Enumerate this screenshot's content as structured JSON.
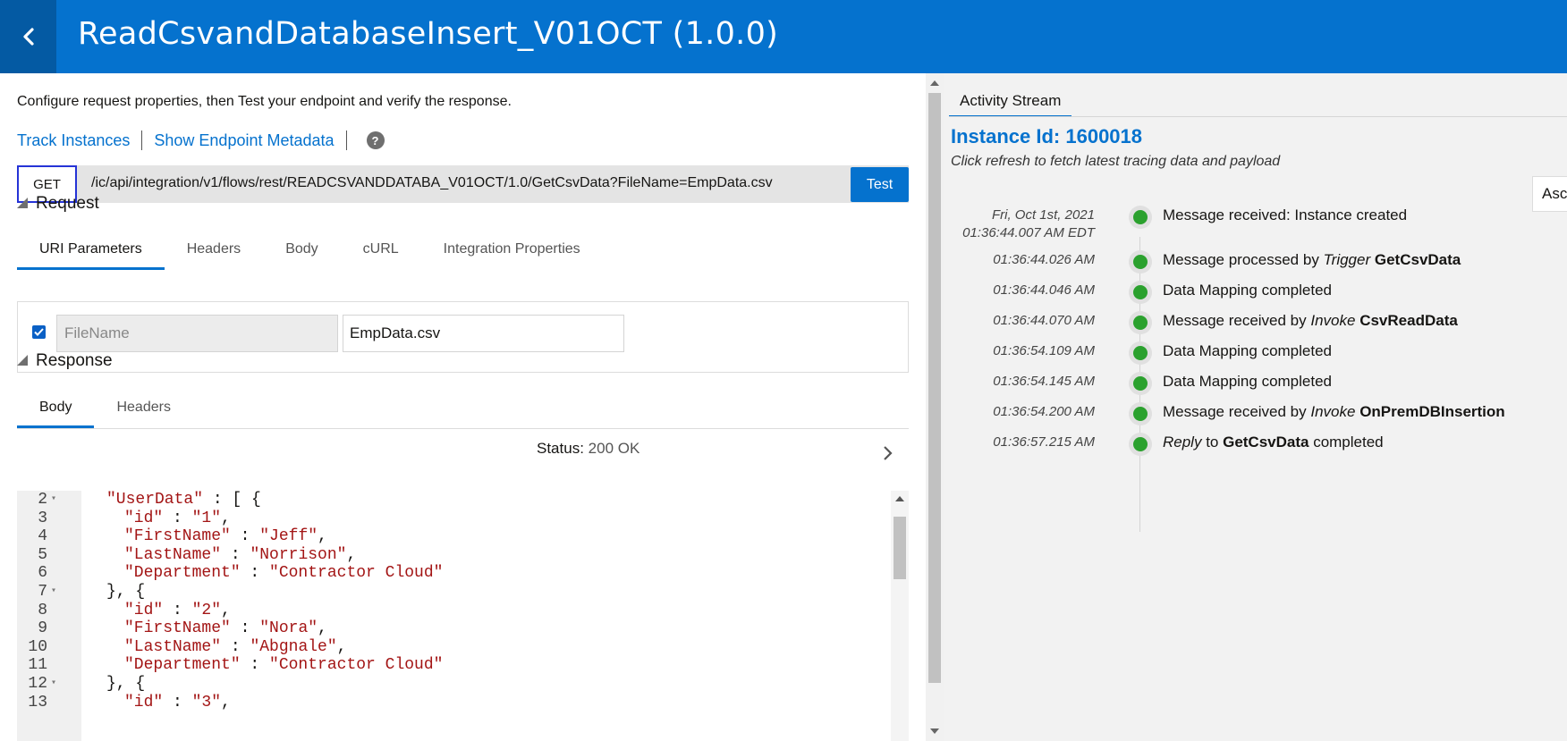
{
  "header": {
    "title": "ReadCsvandDatabaseInsert_V01OCT (1.0.0)",
    "accent": "#0572ce"
  },
  "intro": "Configure request properties, then Test your endpoint and verify the response.",
  "links": {
    "track": "Track Instances",
    "metadata": "Show Endpoint Metadata",
    "help": "?"
  },
  "endpoint": {
    "method": "GET",
    "url": "/ic/api/integration/v1/flows/rest/READCSVANDDATABA_V01OCT/1.0/GetCsvData?FileName=EmpData.csv",
    "test_label": "Test"
  },
  "request": {
    "title": "Request",
    "tabs": [
      "URI Parameters",
      "Headers",
      "Body",
      "cURL",
      "Integration Properties"
    ],
    "active_tab": "URI Parameters",
    "param": {
      "checked": true,
      "name_placeholder": "FileName",
      "value": "EmpData.csv"
    }
  },
  "response": {
    "title": "Response",
    "tabs": [
      "Body",
      "Headers"
    ],
    "active_tab": "Body",
    "status_label": "Status:",
    "status_value": "200 OK",
    "lines": [
      {
        "n": "2",
        "fold": true,
        "indent": 0,
        "parts": [
          [
            "s",
            "\"UserData\""
          ],
          [
            "p",
            " : [ {"
          ]
        ]
      },
      {
        "n": "3",
        "fold": false,
        "indent": 1,
        "parts": [
          [
            "s",
            "\"id\""
          ],
          [
            "p",
            " : "
          ],
          [
            "s",
            "\"1\""
          ],
          [
            "p",
            ","
          ]
        ]
      },
      {
        "n": "4",
        "fold": false,
        "indent": 1,
        "parts": [
          [
            "s",
            "\"FirstName\""
          ],
          [
            "p",
            " : "
          ],
          [
            "s",
            "\"Jeff\""
          ],
          [
            "p",
            ","
          ]
        ]
      },
      {
        "n": "5",
        "fold": false,
        "indent": 1,
        "parts": [
          [
            "s",
            "\"LastName\""
          ],
          [
            "p",
            " : "
          ],
          [
            "s",
            "\"Norrison\""
          ],
          [
            "p",
            ","
          ]
        ]
      },
      {
        "n": "6",
        "fold": false,
        "indent": 1,
        "parts": [
          [
            "s",
            "\"Department\""
          ],
          [
            "p",
            " : "
          ],
          [
            "s",
            "\"Contractor Cloud\""
          ]
        ]
      },
      {
        "n": "7",
        "fold": true,
        "indent": 0,
        "parts": [
          [
            "p",
            "}, {"
          ]
        ]
      },
      {
        "n": "8",
        "fold": false,
        "indent": 1,
        "parts": [
          [
            "s",
            "\"id\""
          ],
          [
            "p",
            " : "
          ],
          [
            "s",
            "\"2\""
          ],
          [
            "p",
            ","
          ]
        ]
      },
      {
        "n": "9",
        "fold": false,
        "indent": 1,
        "parts": [
          [
            "s",
            "\"FirstName\""
          ],
          [
            "p",
            " : "
          ],
          [
            "s",
            "\"Nora\""
          ],
          [
            "p",
            ","
          ]
        ]
      },
      {
        "n": "10",
        "fold": false,
        "indent": 1,
        "parts": [
          [
            "s",
            "\"LastName\""
          ],
          [
            "p",
            " : "
          ],
          [
            "s",
            "\"Abgnale\""
          ],
          [
            "p",
            ","
          ]
        ]
      },
      {
        "n": "11",
        "fold": false,
        "indent": 1,
        "parts": [
          [
            "s",
            "\"Department\""
          ],
          [
            "p",
            " : "
          ],
          [
            "s",
            "\"Contractor Cloud\""
          ]
        ]
      },
      {
        "n": "12",
        "fold": true,
        "indent": 0,
        "parts": [
          [
            "p",
            "}, {"
          ]
        ]
      },
      {
        "n": "13",
        "fold": false,
        "indent": 1,
        "parts": [
          [
            "s",
            "\"id\""
          ],
          [
            "p",
            " : "
          ],
          [
            "s",
            "\"3\""
          ],
          [
            "p",
            ","
          ]
        ]
      }
    ]
  },
  "activity": {
    "tab": "Activity Stream",
    "instance": "Instance Id: 1600018",
    "hint": "Click refresh to fetch latest tracing data and payload",
    "sort_label": "Ascending",
    "events": [
      {
        "time": "Fri, Oct 1st, 2021",
        "time2": "01:36:44.007 AM EDT",
        "parts": [
          [
            "t",
            "Message received: Instance created"
          ]
        ]
      },
      {
        "time": "01:36:44.026 AM",
        "parts": [
          [
            "t",
            "Message processed by "
          ],
          [
            "i",
            "Trigger"
          ],
          [
            "t",
            " "
          ],
          [
            "b",
            "GetCsvData"
          ]
        ]
      },
      {
        "time": "01:36:44.046 AM",
        "parts": [
          [
            "t",
            "Data Mapping completed"
          ]
        ]
      },
      {
        "time": "01:36:44.070 AM",
        "parts": [
          [
            "t",
            "Message received by "
          ],
          [
            "i",
            "Invoke"
          ],
          [
            "t",
            " "
          ],
          [
            "b",
            "CsvReadData"
          ]
        ]
      },
      {
        "time": "01:36:54.109 AM",
        "parts": [
          [
            "t",
            "Data Mapping completed"
          ]
        ]
      },
      {
        "time": "01:36:54.145 AM",
        "parts": [
          [
            "t",
            "Data Mapping completed"
          ]
        ]
      },
      {
        "time": "01:36:54.200 AM",
        "parts": [
          [
            "t",
            "Message received by "
          ],
          [
            "i",
            "Invoke"
          ],
          [
            "t",
            " "
          ],
          [
            "b",
            "OnPremDBInsertion"
          ]
        ]
      },
      {
        "time": "01:36:57.215 AM",
        "parts": [
          [
            "i",
            "Reply"
          ],
          [
            "t",
            " to "
          ],
          [
            "b",
            "GetCsvData"
          ],
          [
            "t",
            " completed"
          ]
        ]
      }
    ]
  }
}
